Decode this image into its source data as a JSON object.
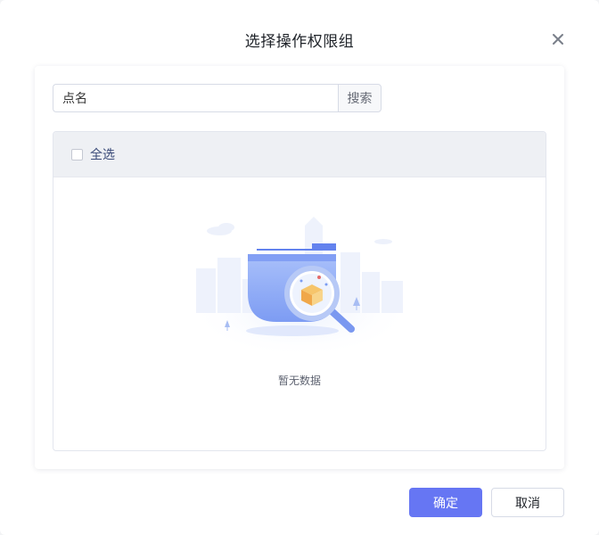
{
  "dialog": {
    "title": "选择操作权限组",
    "close_icon": "close-icon"
  },
  "search": {
    "value": "点名",
    "placeholder": "",
    "button_label": "搜索"
  },
  "list": {
    "select_all_label": "全选",
    "select_all_checked": false,
    "items": [],
    "empty_text": "暂无数据",
    "empty_icon": "empty-folder-magnifier-illustration"
  },
  "footer": {
    "confirm_label": "确定",
    "cancel_label": "取消"
  },
  "colors": {
    "primary": "#6676f3",
    "header_bg": "#eef0f4",
    "illustration_blue": "#7b9cf2"
  }
}
